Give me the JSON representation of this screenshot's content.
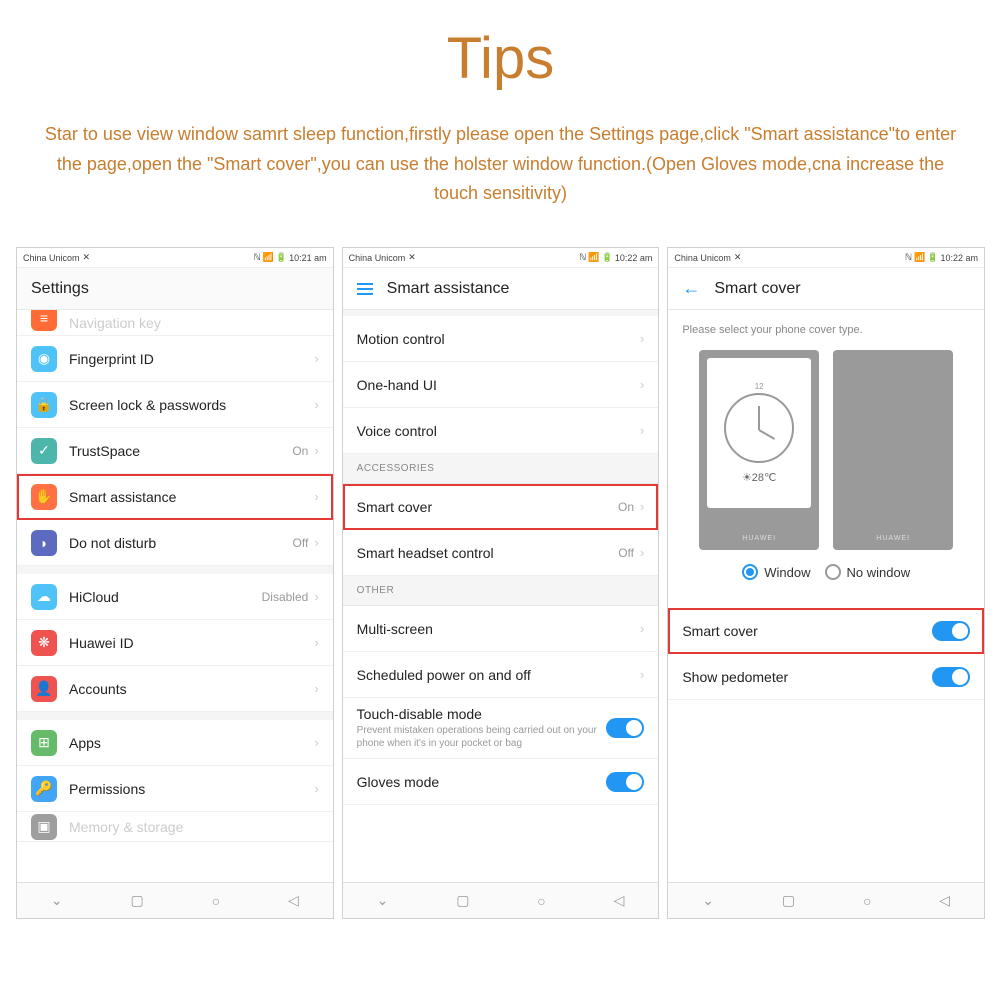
{
  "header": {
    "title": "Tips",
    "description": "Star to use view window samrt sleep function,firstly please open the Settings page,click \"Smart assistance\"to enter the page,open the \"Smart cover\",you can use the holster window function.(Open Gloves mode,cna increase the touch sensitivity)"
  },
  "statusbar": {
    "carrier": "China Unicom",
    "time1": "10:21 am",
    "time2": "10:22 am",
    "time3": "10:22 am"
  },
  "screen1": {
    "title": "Settings",
    "items": [
      {
        "label": "Navigation key",
        "color": "#ff6b35",
        "icon": "≡"
      },
      {
        "label": "Fingerprint ID",
        "color": "#4fc3f7",
        "icon": "◉"
      },
      {
        "label": "Screen lock & passwords",
        "color": "#4fc3f7",
        "icon": "🔒"
      },
      {
        "label": "TrustSpace",
        "color": "#4db6ac",
        "icon": "✓",
        "status": "On"
      },
      {
        "label": "Smart assistance",
        "color": "#ff7043",
        "icon": "✋",
        "highlight": true
      },
      {
        "label": "Do not disturb",
        "color": "#5c6bc0",
        "icon": "◗",
        "status": "Off"
      },
      {
        "label": "HiCloud",
        "color": "#4fc3f7",
        "icon": "☁",
        "status": "Disabled"
      },
      {
        "label": "Huawei ID",
        "color": "#ef5350",
        "icon": "❋"
      },
      {
        "label": "Accounts",
        "color": "#ef5350",
        "icon": "👤"
      },
      {
        "label": "Apps",
        "color": "#66bb6a",
        "icon": "⊞"
      },
      {
        "label": "Permissions",
        "color": "#42a5f5",
        "icon": "🔑"
      },
      {
        "label": "Memory & storage",
        "color": "#9e9e9e",
        "icon": "▣"
      }
    ]
  },
  "screen2": {
    "title": "Smart assistance",
    "groups": [
      {
        "items": [
          {
            "label": "Motion control"
          },
          {
            "label": "One-hand UI"
          },
          {
            "label": "Voice control"
          }
        ]
      },
      {
        "header": "ACCESSORIES",
        "items": [
          {
            "label": "Smart cover",
            "status": "On",
            "highlight": true
          },
          {
            "label": "Smart headset control",
            "status": "Off"
          }
        ]
      },
      {
        "header": "OTHER",
        "items": [
          {
            "label": "Multi-screen"
          },
          {
            "label": "Scheduled power on and off"
          },
          {
            "label": "Touch-disable mode",
            "sub": "Prevent mistaken operations being carried out on your phone when it's in your pocket or bag",
            "toggle": true
          },
          {
            "label": "Gloves mode",
            "toggle": true
          }
        ]
      }
    ]
  },
  "screen3": {
    "title": "Smart cover",
    "hint": "Please select your phone cover type.",
    "clock_num": "12",
    "temp": "☀28℃",
    "brand": "HUAWEI",
    "opt1": "Window",
    "opt2": "No window",
    "rows": [
      {
        "label": "Smart cover",
        "highlight": true
      },
      {
        "label": "Show pedometer"
      }
    ]
  }
}
